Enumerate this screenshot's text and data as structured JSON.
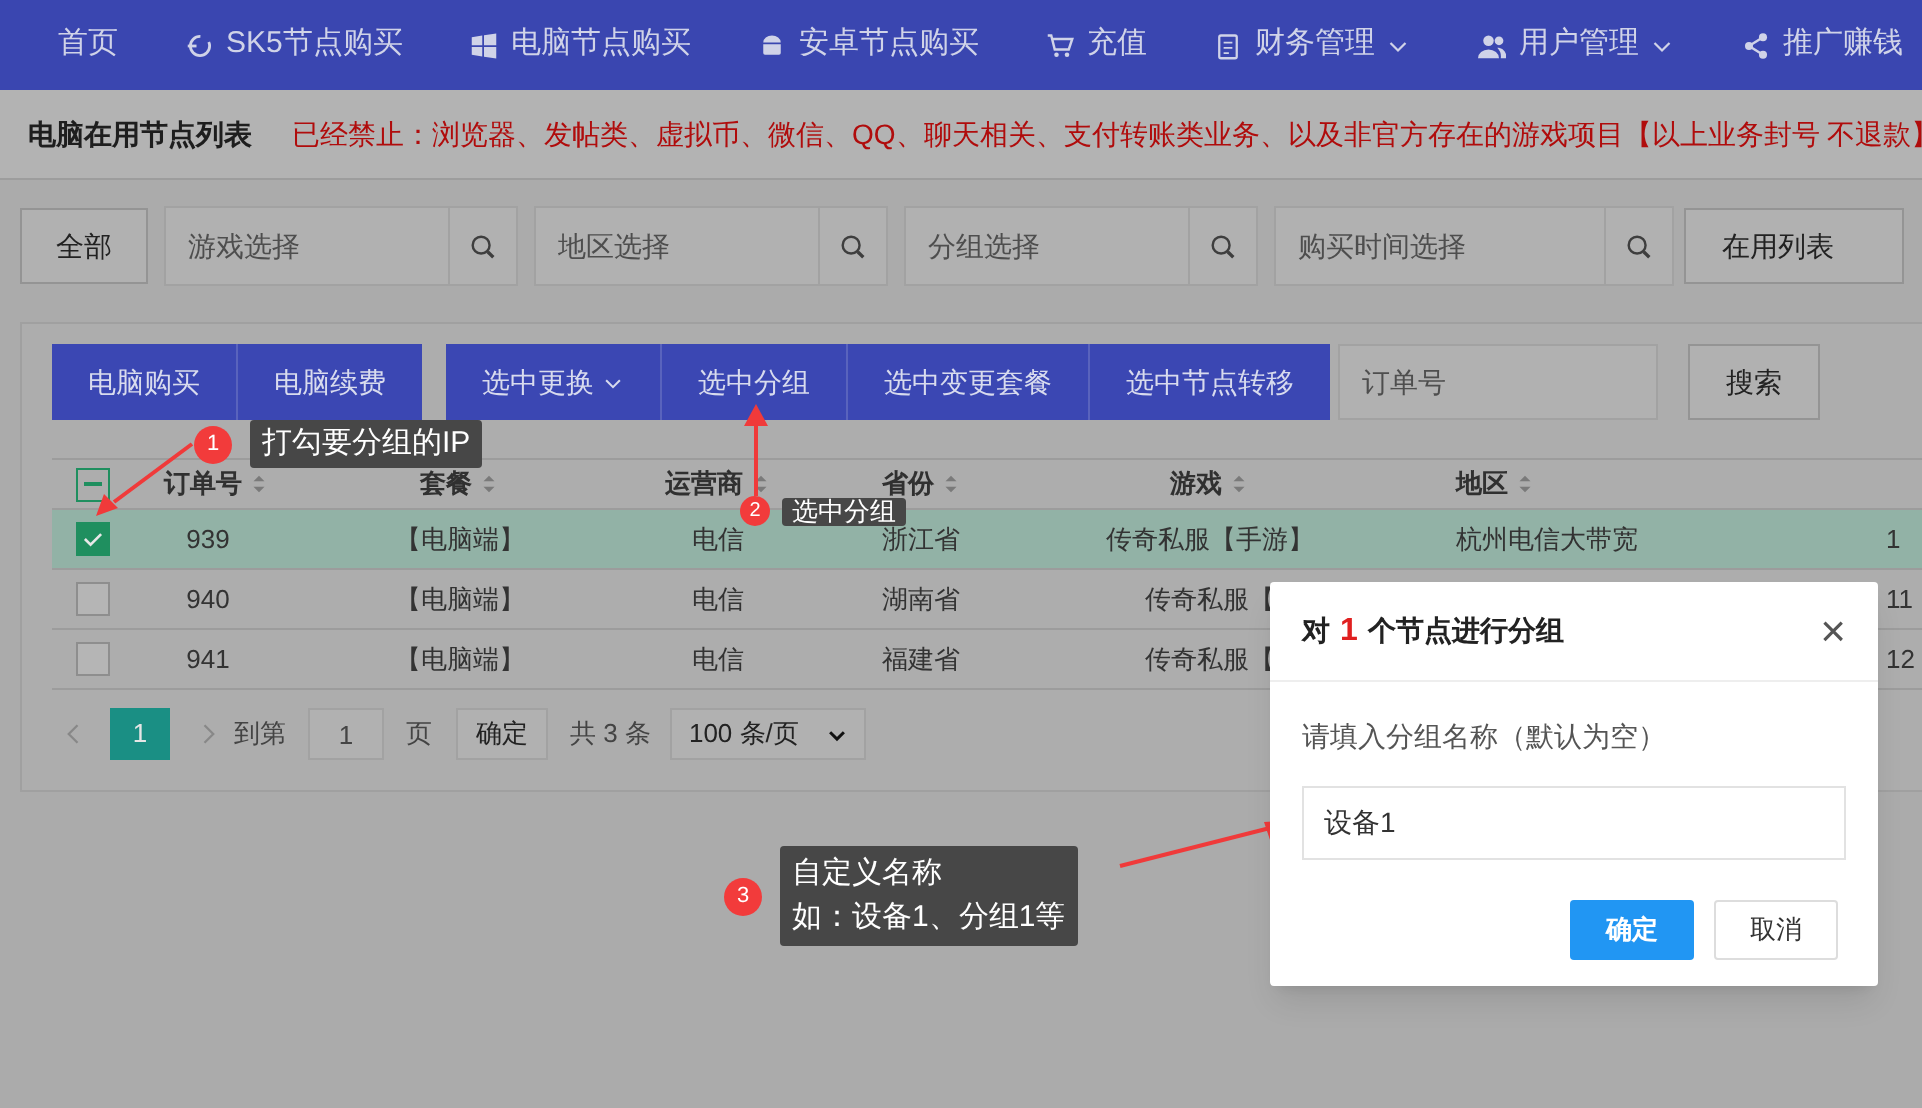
{
  "nav": [
    {
      "label": "首页",
      "has_menu": false
    },
    {
      "label": "SK5节点购买",
      "has_menu": false
    },
    {
      "label": "电脑节点购买",
      "has_menu": false
    },
    {
      "label": "安卓节点购买",
      "has_menu": false
    },
    {
      "label": "充值",
      "has_menu": false
    },
    {
      "label": "财务管理",
      "has_menu": true
    },
    {
      "label": "用户管理",
      "has_menu": true
    },
    {
      "label": "推广赚钱",
      "has_menu": false
    }
  ],
  "notice": {
    "title": "电脑在用节点列表",
    "text": "已经禁止：浏览器、发帖类、虚拟币、微信、QQ、聊天相关、支付转账类业务、以及非官方存在的游戏项目【以上业务封号 不退款】"
  },
  "filters": {
    "all_button": "全部",
    "selects": [
      {
        "placeholder": "游戏选择"
      },
      {
        "placeholder": "地区选择"
      },
      {
        "placeholder": "分组选择"
      },
      {
        "placeholder": "购买时间选择"
      }
    ],
    "list_button": "在用列表"
  },
  "toolbar": {
    "groups": [
      [
        {
          "label": "电脑购买",
          "has_menu": false
        },
        {
          "label": "电脑续费",
          "has_menu": false
        }
      ],
      [
        {
          "label": "选中更换",
          "has_menu": true
        },
        {
          "label": "选中分组",
          "has_menu": false
        },
        {
          "label": "选中变更套餐",
          "has_menu": false
        },
        {
          "label": "选中节点转移",
          "has_menu": false
        }
      ]
    ],
    "order_field": {
      "placeholder": "订单号"
    },
    "search_button": "搜索"
  },
  "table": {
    "header_checkbox": {
      "indeterminate": true
    },
    "columns": [
      {
        "label": "订单号"
      },
      {
        "label": "套餐"
      },
      {
        "label": "运营商"
      },
      {
        "label": "省份"
      },
      {
        "label": "游戏"
      },
      {
        "label": "地区"
      }
    ],
    "rows": [
      {
        "selected": true,
        "checked": true,
        "cells": [
          "939",
          "【电脑端】",
          "电信",
          "浙江省",
          "传奇私服【手游】",
          "杭州电信大带宽",
          "1"
        ]
      },
      {
        "selected": false,
        "checked": false,
        "cells": [
          "940",
          "【电脑端】",
          "电信",
          "湖南省",
          "传奇私服【",
          "",
          "11"
        ]
      },
      {
        "selected": false,
        "checked": false,
        "cells": [
          "941",
          "【电脑端】",
          "电信",
          "福建省",
          "传奇私服【",
          "",
          "12"
        ]
      }
    ]
  },
  "pagination": {
    "current_page": "1",
    "goto_label": "到第",
    "goto_value": "1",
    "page_unit": "页",
    "confirm": "确定",
    "total": "共 3 条",
    "page_size": "100 条/页"
  },
  "dialog": {
    "title_prefix": "对",
    "count": "1",
    "title_suffix": "个节点进行分组",
    "close": "×",
    "label": "请填入分组名称（默认为空）",
    "value": "设备1",
    "ok": "确定",
    "cancel": "取消"
  },
  "annotations": [
    {
      "number": "1",
      "lines": [
        "打勾要分组的IP"
      ]
    },
    {
      "number": "2",
      "lines": [
        "选中分组"
      ]
    },
    {
      "number": "3",
      "lines": [
        "自定义名称",
        "如：设备1、分组1等"
      ]
    }
  ]
}
